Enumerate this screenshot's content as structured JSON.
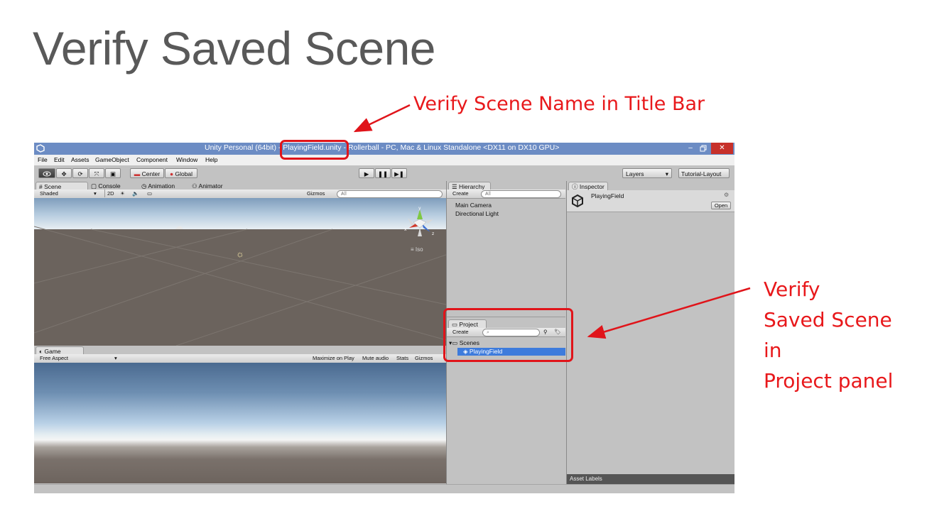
{
  "slide": {
    "title": "Verify Saved Scene",
    "callout_title_bar": "Verify Scene Name in Title Bar",
    "callout_project_lines": [
      "Verify",
      "Saved Scene",
      "in",
      "Project panel"
    ],
    "accent_color": "#e8181b"
  },
  "window": {
    "title_prefix": "Unity Personal (64bit) - ",
    "title_scene": "PlayingField.unity",
    "title_suffix": " - Rollerball - PC, Mac & Linux Standalone <DX11 on DX10 GPU>",
    "minimize": "–",
    "restore": "🗗",
    "close": "✕"
  },
  "menu": [
    "File",
    "Edit",
    "Assets",
    "GameObject",
    "Component",
    "Window",
    "Help"
  ],
  "toolbar": {
    "pivot": "Center",
    "space": "Global",
    "layers": "Layers",
    "layout": "Tutorial-Layout"
  },
  "scene_panel": {
    "tabs": [
      "Scene",
      "Console",
      "Animation",
      "Animator"
    ],
    "shading": "Shaded",
    "mode_2d": "2D",
    "gizmos": "Gizmos",
    "search_placeholder": "All",
    "projection": "Iso"
  },
  "game_panel": {
    "tab": "Game",
    "aspect": "Free Aspect",
    "buttons": [
      "Maximize on Play",
      "Mute audio",
      "Stats",
      "Gizmos"
    ]
  },
  "hierarchy": {
    "tab": "Hierarchy",
    "create": "Create",
    "search_placeholder": "All",
    "items": [
      "Main Camera",
      "Directional Light"
    ]
  },
  "project": {
    "tab": "Project",
    "create": "Create",
    "folder": "Scenes",
    "selected_item": "PlayingField"
  },
  "inspector": {
    "tab": "Inspector",
    "object_name": "PlayingField",
    "open_button": "Open",
    "asset_labels": "Asset Labels"
  }
}
